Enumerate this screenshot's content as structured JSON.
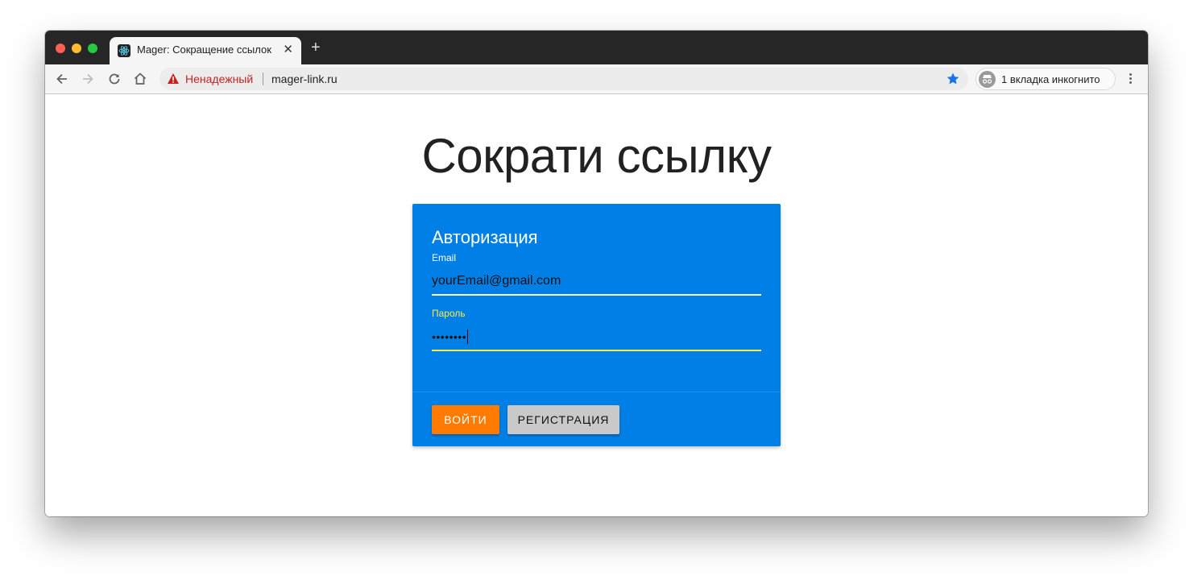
{
  "browser": {
    "tab_title": "Mager: Сокращение ссылок",
    "tab_close": "✕",
    "new_tab": "+",
    "security_label": "Ненадежный",
    "url": "mager-link.ru",
    "incognito_label": "1 вкладка инкогнито"
  },
  "page": {
    "heading": "Сократи ссылку",
    "card": {
      "title": "Авторизация",
      "email_label": "Email",
      "email_value": "yourEmail@gmail.com",
      "password_label": "Пароль",
      "password_value": "••••••••",
      "login_button": "ВОЙТИ",
      "register_button": "РЕГИСТРАЦИЯ"
    }
  },
  "colors": {
    "card_bg": "#0080e6",
    "login_button": "#ff7a00",
    "register_button": "#c9c9c9",
    "focus_accent": "#ffeb3b",
    "insecure_text": "#c5221f"
  },
  "icons": [
    "back-arrow-icon",
    "forward-arrow-icon",
    "reload-icon",
    "home-icon",
    "warning-icon",
    "bookmark-star-icon",
    "incognito-icon",
    "more-vert-icon",
    "react-favicon-icon"
  ]
}
